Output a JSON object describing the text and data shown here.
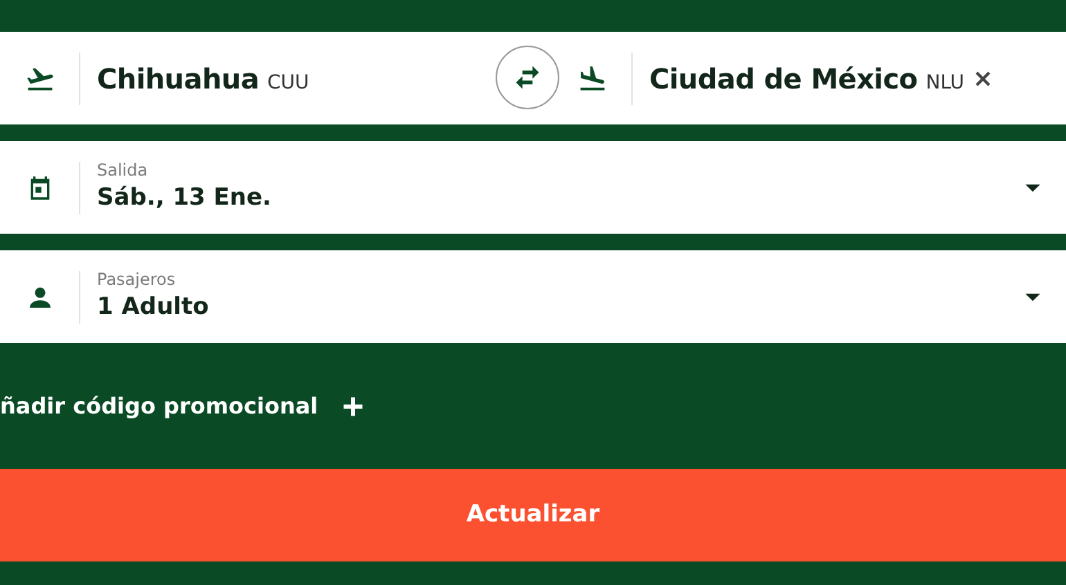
{
  "route": {
    "origin": {
      "city": "Chihuahua",
      "code": "CUU"
    },
    "destination": {
      "city": "Ciudad de México",
      "code": "NLU"
    }
  },
  "fields": [
    {
      "kind": "date",
      "label": "Salida",
      "value": "Sáb., 13 Ene."
    },
    {
      "kind": "passengers",
      "label": "Pasajeros",
      "value": "1 Adulto"
    }
  ],
  "promo": {
    "label": "ñadir código promocional"
  },
  "submit": {
    "label": "Actualizar"
  }
}
